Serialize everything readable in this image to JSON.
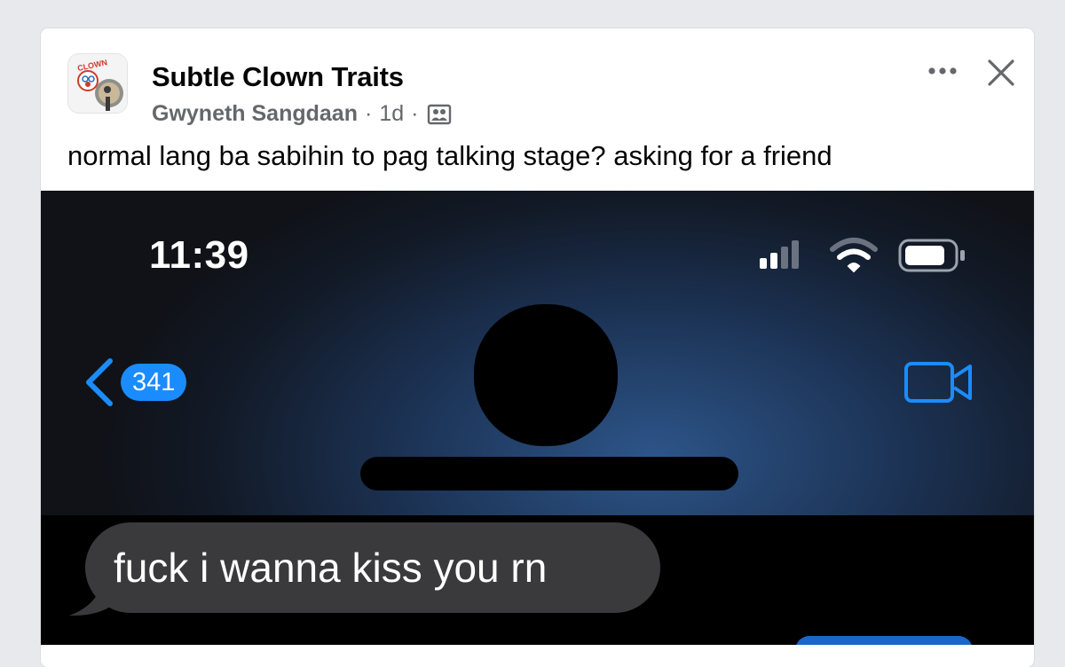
{
  "post": {
    "group_name": "Subtle Clown Traits",
    "author": "Gwyneth Sangdaan",
    "separator": "·",
    "time": "1d",
    "caption": "normal lang ba sabihin to pag talking stage? asking for a friend",
    "avatar_logo_text": "CLOWN"
  },
  "actions": {
    "more_icon": "more-horizontal-icon",
    "close_icon": "close-icon"
  },
  "screenshot": {
    "clock": "11:39",
    "back_badge": "341",
    "message": "fuck i wanna kiss you rn"
  },
  "colors": {
    "ios_blue": "#1a8cff",
    "bubble_gray": "#3a3a3c",
    "fb_secondary_text": "#65676b"
  }
}
